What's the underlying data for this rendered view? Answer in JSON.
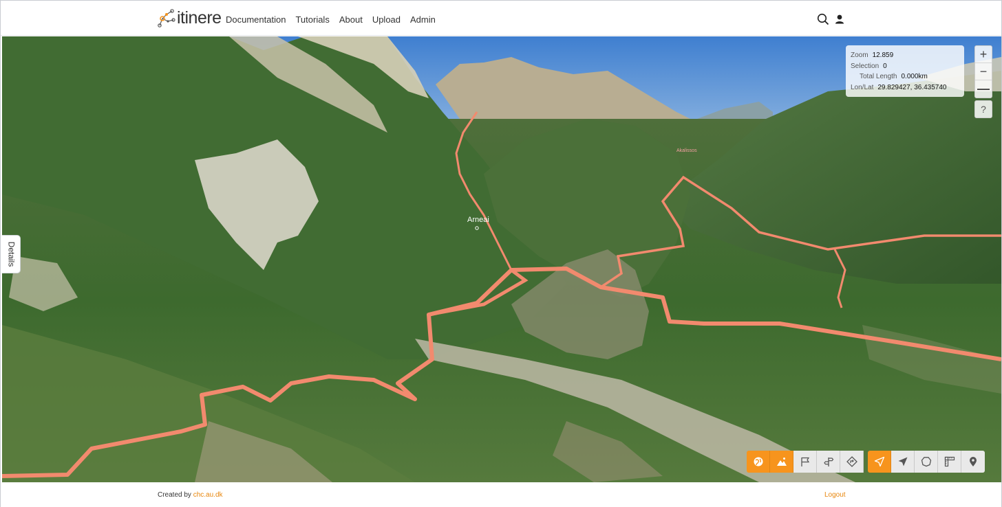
{
  "app": {
    "brand": "itinere"
  },
  "nav": {
    "items": [
      "Documentation",
      "Tutorials",
      "About",
      "Upload",
      "Admin"
    ]
  },
  "header_icons": [
    "search-icon",
    "user-icon"
  ],
  "side_tab": {
    "label": "Details"
  },
  "map_labels": {
    "town_1": "Arneai",
    "town_2": "Akalissos"
  },
  "info_panel": {
    "zoom_label": "Zoom",
    "zoom_value": "12.859",
    "selection_label": "Selection",
    "selection_value": "0",
    "length_label": "Total Length",
    "length_value": "0.000km",
    "lonlat_label": "Lon/Lat",
    "lonlat_value": "29.829427, 36.435740"
  },
  "map_controls": {
    "zoom_in": "+",
    "zoom_out": "−",
    "compass": "—",
    "help": "?"
  },
  "toolbar": [
    {
      "icon": "globe-icon",
      "active": true
    },
    {
      "icon": "terrain-icon",
      "active": true
    },
    {
      "icon": "flag-icon",
      "active": false
    },
    {
      "icon": "signpost-icon",
      "active": false
    },
    {
      "icon": "route-sign-icon",
      "active": false
    },
    {
      "icon": "send-icon",
      "active": true
    },
    {
      "icon": "navigate-icon",
      "active": false
    },
    {
      "icon": "polygon-icon",
      "active": false
    },
    {
      "icon": "ruler-icon",
      "active": false
    },
    {
      "icon": "location-pin-icon",
      "active": false
    }
  ],
  "colors": {
    "accent": "#f7941d",
    "route": "#f28a6e",
    "sky": "#4f8fd6",
    "link": "#e8860c"
  },
  "footer": {
    "created_by": "Created by",
    "created_link": "chc.au.dk",
    "logout": "Logout"
  }
}
